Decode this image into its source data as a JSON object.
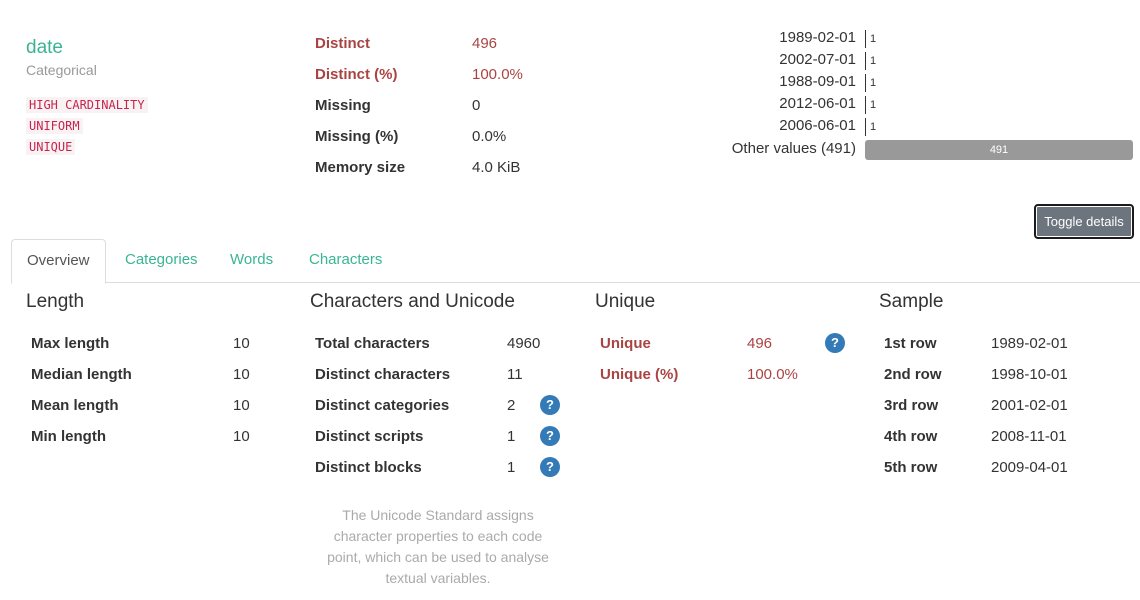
{
  "variable": {
    "name": "date",
    "type": "Categorical",
    "badges": [
      "HIGH CARDINALITY",
      "UNIFORM",
      "UNIQUE"
    ]
  },
  "stats": [
    {
      "label": "Distinct",
      "value": "496",
      "alert": true
    },
    {
      "label": "Distinct (%)",
      "value": "100.0%",
      "alert": true
    },
    {
      "label": "Missing",
      "value": "0",
      "alert": false
    },
    {
      "label": "Missing (%)",
      "value": "0.0%",
      "alert": false
    },
    {
      "label": "Memory size",
      "value": "4.0 KiB",
      "alert": false
    }
  ],
  "frequencies": {
    "items": [
      {
        "label": "1989-02-01",
        "count": "1"
      },
      {
        "label": "2002-07-01",
        "count": "1"
      },
      {
        "label": "1988-09-01",
        "count": "1"
      },
      {
        "label": "2012-06-01",
        "count": "1"
      },
      {
        "label": "2006-06-01",
        "count": "1"
      }
    ],
    "other_label": "Other values (491)",
    "other_count": "491"
  },
  "toggle_label": "Toggle details",
  "tabs": [
    "Overview",
    "Categories",
    "Words",
    "Characters"
  ],
  "length": {
    "title": "Length",
    "rows": [
      {
        "label": "Max length",
        "value": "10"
      },
      {
        "label": "Median length",
        "value": "10"
      },
      {
        "label": "Mean length",
        "value": "10"
      },
      {
        "label": "Min length",
        "value": "10"
      }
    ]
  },
  "unicode": {
    "title": "Characters and Unicode",
    "rows": [
      {
        "label": "Total characters",
        "value": "4960"
      },
      {
        "label": "Distinct characters",
        "value": "11"
      },
      {
        "label": "Distinct categories",
        "value": "2"
      },
      {
        "label": "Distinct scripts",
        "value": "1"
      },
      {
        "label": "Distinct blocks",
        "value": "1"
      }
    ],
    "note": "The Unicode Standard assigns character properties to each code point, which can be used to analyse textual variables."
  },
  "unique": {
    "title": "Unique",
    "rows": [
      {
        "label": "Unique",
        "value": "496"
      },
      {
        "label": "Unique (%)",
        "value": "100.0%"
      }
    ]
  },
  "sample": {
    "title": "Sample",
    "rows": [
      {
        "label": "1st row",
        "value": "1989-02-01"
      },
      {
        "label": "2nd row",
        "value": "1998-10-01"
      },
      {
        "label": "3rd row",
        "value": "2001-02-01"
      },
      {
        "label": "4th row",
        "value": "2008-11-01"
      },
      {
        "label": "5th row",
        "value": "2009-04-01"
      }
    ]
  },
  "help_glyph": "?"
}
